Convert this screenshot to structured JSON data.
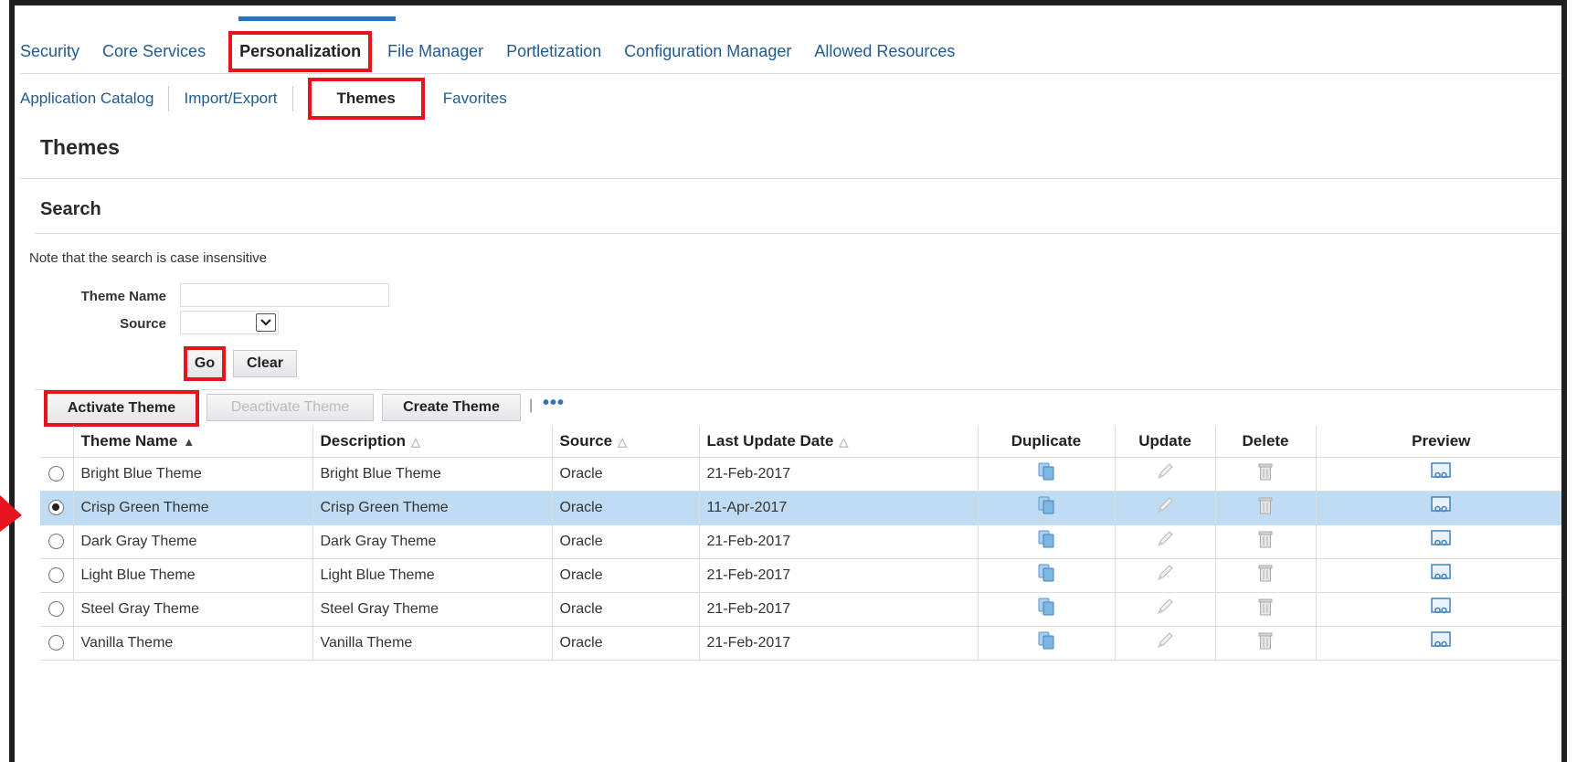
{
  "tabs_primary": [
    {
      "label": "Security",
      "active": false
    },
    {
      "label": "Core Services",
      "active": false
    },
    {
      "label": "Personalization",
      "active": true
    },
    {
      "label": "File Manager",
      "active": false
    },
    {
      "label": "Portletization",
      "active": false
    },
    {
      "label": "Configuration Manager",
      "active": false
    },
    {
      "label": "Allowed Resources",
      "active": false
    }
  ],
  "tabs_secondary": [
    {
      "label": "Application Catalog",
      "active": false
    },
    {
      "label": "Import/Export",
      "active": false
    },
    {
      "label": "Themes",
      "active": true
    },
    {
      "label": "Favorites",
      "active": false
    }
  ],
  "page_title": "Themes",
  "search": {
    "heading": "Search",
    "note": "Note that the search is case insensitive",
    "theme_name_label": "Theme Name",
    "theme_name_value": "",
    "source_label": "Source",
    "source_value": "",
    "go_label": "Go",
    "clear_label": "Clear"
  },
  "actions": {
    "activate": "Activate Theme",
    "deactivate": "Deactivate Theme",
    "create": "Create Theme",
    "pipe": "|",
    "more": "•••"
  },
  "table": {
    "headers": {
      "theme_name": "Theme Name",
      "description": "Description",
      "source": "Source",
      "last_update": "Last Update Date",
      "duplicate": "Duplicate",
      "update": "Update",
      "delete": "Delete",
      "preview": "Preview"
    },
    "sort_icons": {
      "sorted": "▲",
      "unsorted": "△"
    },
    "rows": [
      {
        "name": "Bright Blue Theme",
        "description": "Bright Blue Theme",
        "source": "Oracle",
        "date": "21-Feb-2017",
        "selected": false
      },
      {
        "name": "Crisp Green Theme",
        "description": "Crisp Green Theme",
        "source": "Oracle",
        "date": "11-Apr-2017",
        "selected": true
      },
      {
        "name": "Dark Gray Theme",
        "description": "Dark Gray Theme",
        "source": "Oracle",
        "date": "21-Feb-2017",
        "selected": false
      },
      {
        "name": "Light Blue Theme",
        "description": "Light Blue Theme",
        "source": "Oracle",
        "date": "21-Feb-2017",
        "selected": false
      },
      {
        "name": "Steel Gray Theme",
        "description": "Steel Gray Theme",
        "source": "Oracle",
        "date": "21-Feb-2017",
        "selected": false
      },
      {
        "name": "Vanilla Theme",
        "description": "Vanilla Theme",
        "source": "Oracle",
        "date": "21-Feb-2017",
        "selected": false
      }
    ]
  },
  "colors": {
    "highlight_red": "#e5141f",
    "link_blue": "#235a8f",
    "selected_row": "#bfdcf3",
    "active_tab_bar": "#2f73b3"
  },
  "icons": {
    "duplicate": "duplicate-icon",
    "update": "pencil-icon",
    "delete": "trash-icon",
    "preview": "preview-glasses-icon"
  }
}
